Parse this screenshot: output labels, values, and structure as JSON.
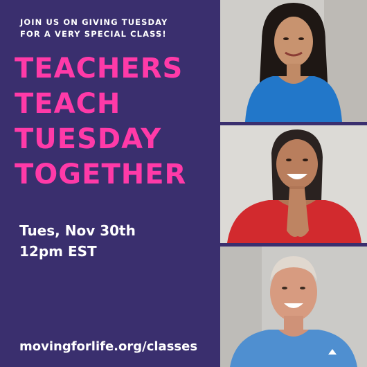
{
  "intro": {
    "line1": "JOIN US ON GIVING TUESDAY",
    "line2": "FOR A VERY SPECIAL CLASS!"
  },
  "headline": {
    "lines": [
      "TEACHERS",
      "TEACH",
      "TUESDAY",
      "TOGETHER"
    ]
  },
  "event": {
    "date": "Tues, Nov 30th",
    "time": "12pm EST"
  },
  "website": "movingforlife.org/classes",
  "colors": {
    "background": "#3a2f6e",
    "headline": "#ff3aa8",
    "text": "#ffffff"
  },
  "photos": [
    {
      "subject": "young woman with long dark hair in blue top"
    },
    {
      "subject": "smiling woman with hands pressed together in red top"
    },
    {
      "subject": "smiling man in blue athletic shirt"
    }
  ]
}
